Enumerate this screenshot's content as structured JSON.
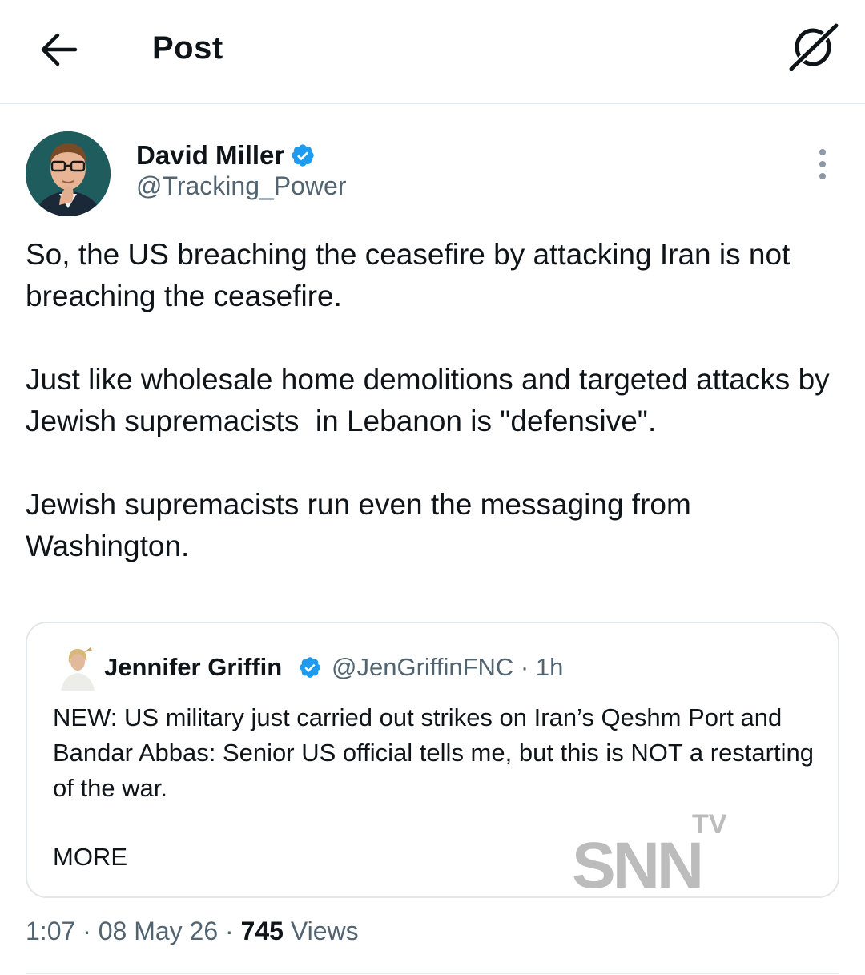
{
  "header": {
    "title": "Post",
    "back_icon": "arrow-left-icon",
    "grok_icon": "grok-icon"
  },
  "tweet": {
    "author_name": "David Miller",
    "author_handle": "@Tracking_Power",
    "verified": true,
    "text": "So, the US breaching the ceasefire by attacking Iran is not breaching the ceasefire.\n\nJust like wholesale home demolitions and targeted attacks by Jewish supremacists  in Lebanon is \"defensive\".\n\nJewish supremacists run even the messaging from Washington.",
    "time": "1:07",
    "date": "08 May 26",
    "views_count": "745",
    "views_label": "Views"
  },
  "quote": {
    "author_name": "Jennifer Griffin",
    "author_handle": "@JenGriffinFNC",
    "age": "1h",
    "text": "NEW: US military just carried out strikes on Iran’s Qeshm Port and Bandar Abbas: Senior US official tells me, but this is NOT a restarting of the war.",
    "more_label": "MORE"
  },
  "watermark": {
    "top": "TV",
    "main": "SNN"
  },
  "colors": {
    "verified_blue": "#1d9bf0",
    "secondary_text": "#536471",
    "primary_text": "#0f1419",
    "divider": "#e6e9ec"
  }
}
